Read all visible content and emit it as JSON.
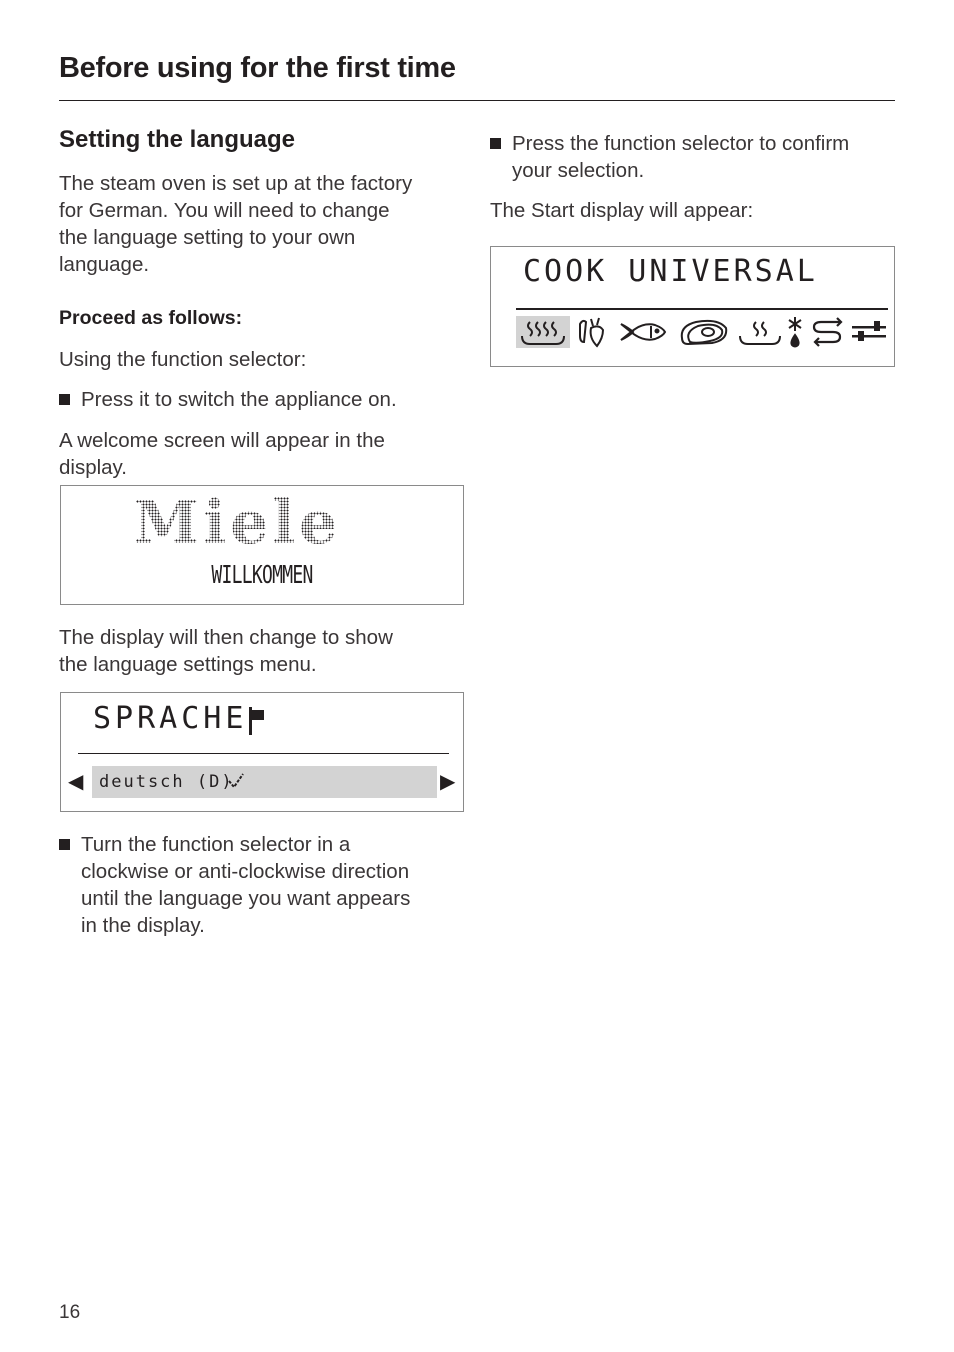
{
  "header": {
    "title": "Before using for the first time"
  },
  "left_column": {
    "section_title": "Setting the language",
    "intro": "The steam oven is set up at the factory for German. You will need to change the language setting to your own language.",
    "intro_lines": [
      "The steam oven is set up at the factory",
      "for German. You will need to change",
      "the language setting to your own",
      "language."
    ],
    "proceed_label": "Proceed as follows:",
    "using_selector": "Using the function selector:",
    "step1": "Press it to switch the appliance on.",
    "welcome_lines": [
      "A welcome screen will appear in the",
      "display."
    ],
    "welcome_display": {
      "logo": "Miele",
      "message": "WILLKOMMEN"
    },
    "change_lines": [
      "The display will then change to show",
      "the language settings menu."
    ],
    "language_display": {
      "title": "SPRACHE",
      "title_icon": "flag-icon",
      "left_arrow": "◀",
      "right_arrow": "▶",
      "selected_option": "deutsch (D)",
      "selected_mark": "checkmark-icon"
    },
    "step2_lines": [
      "Turn the function selector in a",
      "clockwise or anti-clockwise direction",
      "until the language you want appears",
      "in the display."
    ]
  },
  "right_column": {
    "step3_lines": [
      "Press the function selector to confirm",
      "your selection."
    ],
    "start_display_text": "The Start display will appear:",
    "start_display": {
      "title": "COOK UNIVERSAL",
      "icons": [
        {
          "name": "universal-cooking-icon",
          "selected": true
        },
        {
          "name": "vegetables-icon",
          "selected": false
        },
        {
          "name": "fish-icon",
          "selected": false
        },
        {
          "name": "meat-icon",
          "selected": false
        },
        {
          "name": "reheat-icon",
          "selected": false
        },
        {
          "name": "defrost-icon",
          "selected": false
        },
        {
          "name": "menu-cooking-icon",
          "selected": false
        },
        {
          "name": "settings-icon",
          "selected": false
        }
      ]
    }
  },
  "footer": {
    "page_number": "16"
  }
}
